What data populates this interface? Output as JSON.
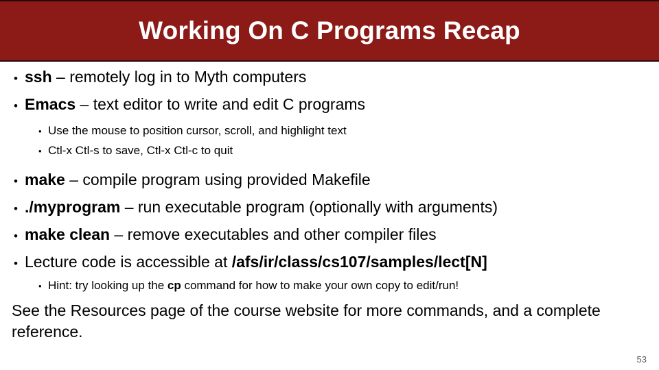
{
  "slide": {
    "title": "Working On C Programs Recap",
    "banner_color": "#8C1A17",
    "title_color": "#FFFFFF",
    "page_number": "53",
    "bullet_glyph": "•"
  },
  "bullets": [
    {
      "level": 1,
      "bold": "ssh",
      "rest": " – remotely log in to Myth computers",
      "pre": ""
    },
    {
      "level": 1,
      "bold": "Emacs",
      "rest": " – text editor to write and edit C programs",
      "pre": ""
    },
    {
      "level": 2,
      "bold": "",
      "rest": "Use the mouse to position cursor, scroll, and highlight text",
      "pre": ""
    },
    {
      "level": 2,
      "bold": "",
      "rest": "Ctl-x Ctl-s to save, Ctl-x Ctl-c to quit",
      "pre": ""
    },
    {
      "level": 1,
      "bold": "make",
      "rest": " – compile program using provided Makefile",
      "pre": ""
    },
    {
      "level": 1,
      "bold": "./myprogram",
      "rest": " – run executable program (optionally with arguments)",
      "pre": ""
    },
    {
      "level": 1,
      "bold": "make clean",
      "rest": " – remove executables and other compiler files",
      "pre": ""
    },
    {
      "level": 1,
      "bold": "/afs/ir/class/cs107/samples/lect[N]",
      "rest": "",
      "pre": "Lecture code is accessible at "
    },
    {
      "level": 2,
      "bold": "cp",
      "rest": " command for how to make your own copy to edit/run!",
      "pre": "Hint: try looking up the "
    }
  ],
  "closing": {
    "text": "See the Resources page of the course website for more commands, and a complete reference."
  }
}
